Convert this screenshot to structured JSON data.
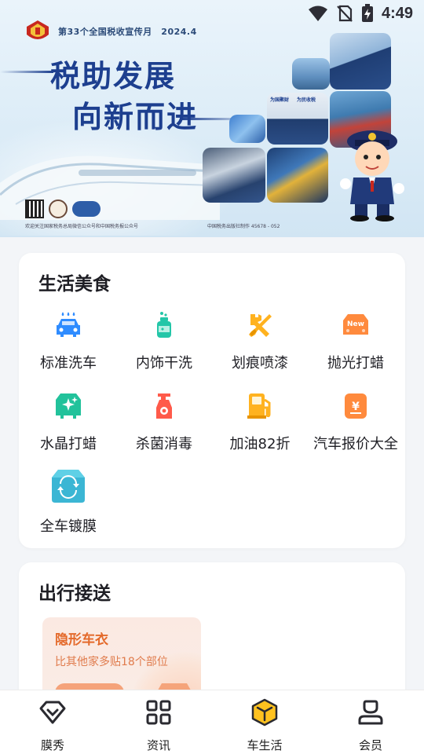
{
  "status_bar": {
    "time": "4:49"
  },
  "banner": {
    "tagline": "第33个全国税收宣传月　2024.4",
    "slogan_line1": "税助发展",
    "slogan_line2": "向新而进",
    "photo_caption_left": "为国聚财",
    "photo_caption_right": "为民收税",
    "footer_left": "欢迎关注国家税务总局微信公众号和中国税务报公众号",
    "footer_right": "中国税务出版社制作 45678 - 052"
  },
  "life_section": {
    "title": "生活美食",
    "items": [
      {
        "label": "标准洗车",
        "icon": "car-wash-icon",
        "color": "#2f8cff"
      },
      {
        "label": "内饰干洗",
        "icon": "spray-bottle-icon",
        "color": "#24c6a8"
      },
      {
        "label": "划痕喷漆",
        "icon": "wrench-screwdriver-icon",
        "color": "#ffb21f"
      },
      {
        "label": "抛光打蜡",
        "icon": "new-badge-icon",
        "color": "#ff8a3d"
      },
      {
        "label": "水晶打蜡",
        "icon": "sparkle-car-icon",
        "color": "#22c29b"
      },
      {
        "label": "杀菌消毒",
        "icon": "disinfect-spray-icon",
        "color": "#ff5a4a"
      },
      {
        "label": "加油82折",
        "icon": "fuel-pump-icon",
        "color": "#ffb21f"
      },
      {
        "label": "汽车报价大全",
        "icon": "price-tag-icon",
        "color": "#ff8a3d"
      },
      {
        "label": "全车镀膜",
        "icon": "car-film-icon",
        "color": "#3bb6d4"
      }
    ]
  },
  "trip_section": {
    "title": "出行接送",
    "promo": {
      "title": "隐形车衣",
      "subtitle": "比其他家多贴18个部位"
    }
  },
  "tabbar": {
    "tabs": [
      {
        "label": "膜秀",
        "icon": "diamond-icon"
      },
      {
        "label": "资讯",
        "icon": "grid-icon"
      },
      {
        "label": "车生活",
        "icon": "cube-icon",
        "active": true,
        "accent": "#ffc21f"
      },
      {
        "label": "会员",
        "icon": "person-icon"
      }
    ]
  }
}
